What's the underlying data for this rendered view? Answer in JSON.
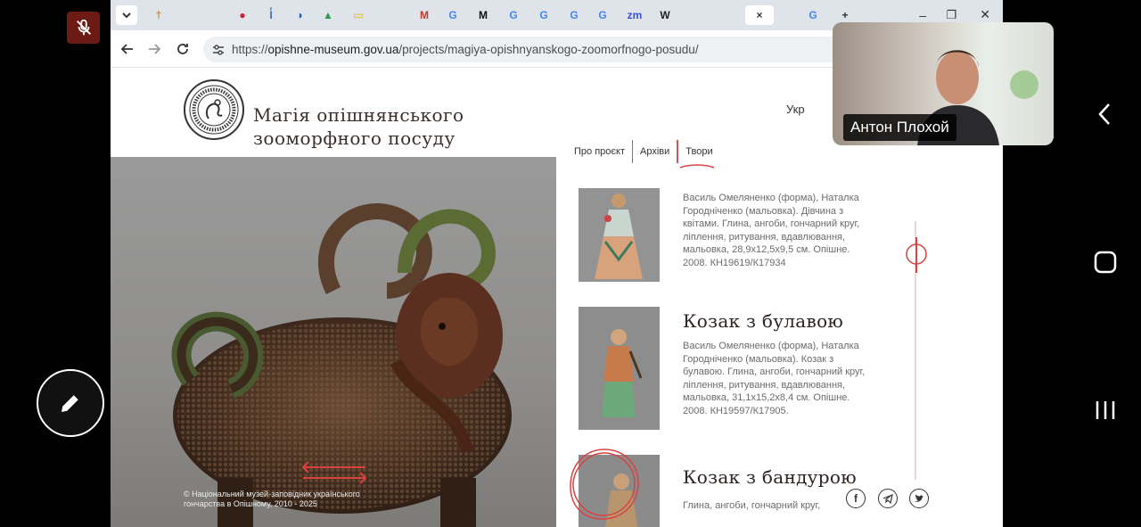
{
  "browser": {
    "url_host": "opishne-museum.gov.ua",
    "url_prefix": "https://",
    "url_path": "/projects/magiya-opishnyanskogo-zoomorfnogo-posudu/",
    "tabs": [
      "†",
      "",
      "",
      "●",
      "I̔",
      "◑",
      "▲",
      "▭",
      "",
      "M",
      "G",
      "M",
      "G",
      "G",
      "G",
      "G",
      "zm",
      "W",
      "",
      "",
      "×",
      "",
      "G",
      "+"
    ],
    "window_controls": [
      "–",
      "❐",
      "✕"
    ]
  },
  "site": {
    "title_line1": "Магія опішнянського",
    "title_line2": "зооморфного посуду",
    "lang": "Укр",
    "nav": [
      "Про проєкт",
      "Архіви",
      "Твори"
    ],
    "hero_copyright_line1": "© Національний музей-заповідник українського",
    "hero_copyright_line2": "гончарства в Опішному, 2010 - 2025"
  },
  "works": [
    {
      "title": "",
      "desc": "Василь Омеляненко (форма), Наталка Городніченко (мальовка). Дівчина з квітами. Глина, ангоби, гончарний круг, ліплення, ритування, вдавлювання, мальовка, 28,9х12,5х9,5 см. Опішне. 2008. КН19619/К17934"
    },
    {
      "title": "Козак з булавою",
      "desc": "Василь Омеляненко (форма), Наталка Городніченко (мальовка). Козак з булавою. Глина, ангоби, гончарний круг, ліплення, ритування, вдавлювання, мальовка, 31,1х15,2х8,4 см. Опішне. 2008. КН19597/К17905."
    },
    {
      "title": "Козак з бандурою",
      "desc": "Глина, ангоби, гончарний круг,"
    }
  ],
  "meeting": {
    "participant_name": "Антон Плохой"
  },
  "colors": {
    "accent_red": "#d9413f",
    "tabstrip": "#dfe3ea",
    "hero_bg": "#8e8d8b"
  },
  "icons": {
    "mic": "mic-off-icon",
    "pen": "pen-icon",
    "back": "back-arrow-icon",
    "nav": [
      "chevron-left-icon",
      "home-square-icon",
      "recents-icon"
    ],
    "social": [
      "facebook-icon",
      "telegram-icon",
      "twitter-icon"
    ]
  }
}
